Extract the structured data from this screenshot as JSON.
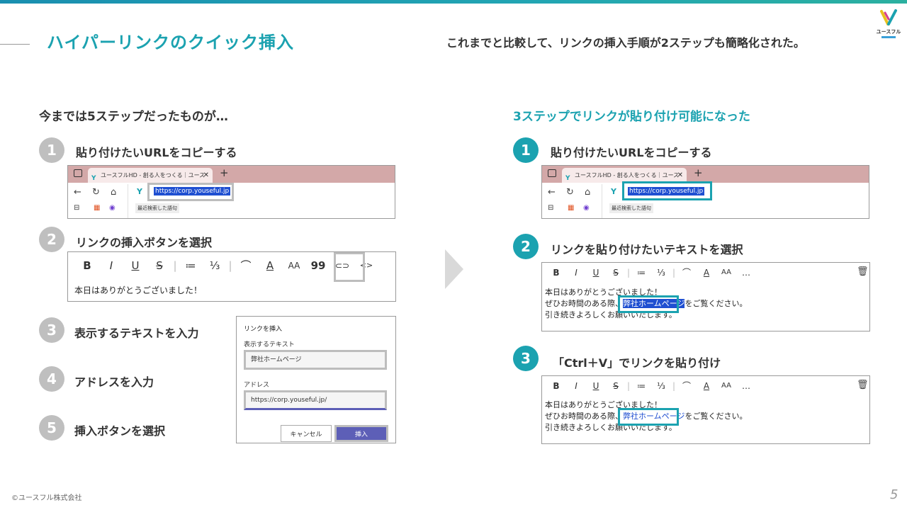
{
  "slide": {
    "title": "ハイパーリンクのクイック挿入",
    "subtitle": "これまでと比較して、リンクの挿入手順が2ステップも簡略化された。",
    "logo_text": "ユースフル",
    "footer": "©ユースフル株式会社",
    "page_number": "5"
  },
  "left": {
    "heading": "今までは5ステップだったものが…",
    "steps": [
      {
        "num": "1",
        "label": "貼り付けたいURLをコピーする"
      },
      {
        "num": "2",
        "label": "リンクの挿入ボタンを選択"
      },
      {
        "num": "3",
        "label": "表示するテキストを入力"
      },
      {
        "num": "4",
        "label": "アドレスを入力"
      },
      {
        "num": "5",
        "label": "挿入ボタンを選択"
      }
    ]
  },
  "right": {
    "heading": "3ステップでリンクが貼り付け可能になった",
    "steps": [
      {
        "num": "1",
        "label": "貼り付けたいURLをコピーする"
      },
      {
        "num": "2",
        "label": "リンクを貼り付けたいテキストを選択"
      },
      {
        "num": "3",
        "label": "「Ctrl＋V」でリンクを貼り付け"
      }
    ]
  },
  "browser": {
    "tab_title": "ユースフルHD - 創る人をつくる｜ユース",
    "url": "https://corp.youseful.jp",
    "recent_search": "最近検索した語句"
  },
  "editor": {
    "toolbar_left": [
      "B",
      "I",
      "U",
      "S",
      "|",
      "≔",
      "⅓",
      "|",
      "⌒",
      "A",
      "AA",
      "99",
      "⊂⊃",
      "<>"
    ],
    "line1": "本日はありがとうございました！",
    "line2_before": "ぜひお時間のある際、",
    "line2_link": "弊社ホームページ",
    "line2_after": "をご覧ください。",
    "line3": "引き続きよろしくお願いいたします。",
    "more": "…"
  },
  "dialog": {
    "title": "リンクを挿入",
    "display_text_label": "表示するテキスト",
    "display_text_value": "弊社ホームページ",
    "address_label": "アドレス",
    "address_value": "https://corp.youseful.jp/",
    "cancel": "キャンセル",
    "insert": "挿入"
  },
  "colors": {
    "accent": "#1ba2b0",
    "gray_step": "#bfbfbf",
    "selection": "#1f4fd1",
    "insert_button": "#5d5fb7",
    "browser_tabbar": "#d3a8a8"
  },
  "icons": [
    "back-arrow-icon",
    "reload-icon",
    "home-icon",
    "tab-close-icon",
    "new-tab-icon",
    "link-icon",
    "trash-icon",
    "chevron-right-arrow"
  ]
}
